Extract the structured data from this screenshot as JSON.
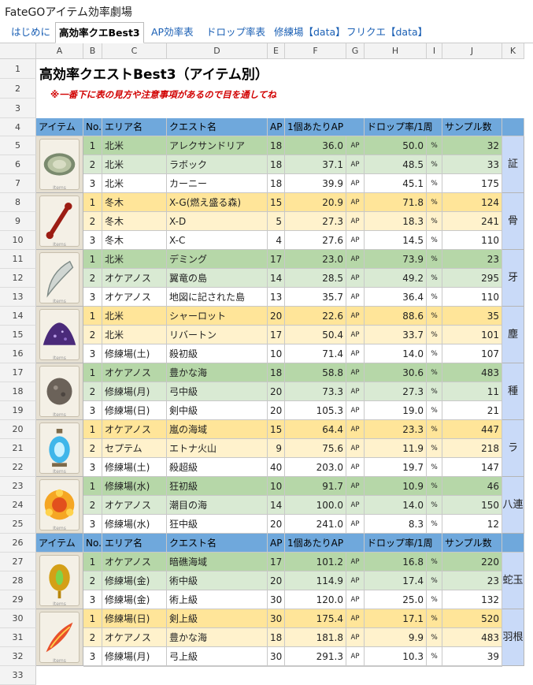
{
  "app": {
    "title": "FateGOアイテム効率劇場"
  },
  "tabs": [
    {
      "label": "はじめに",
      "active": false
    },
    {
      "label": "高効率クエBest3",
      "active": true
    },
    {
      "label": "AP効率表",
      "active": false
    },
    {
      "label": "ドロップ率表",
      "active": false
    },
    {
      "label": "修練場【data】",
      "active": false
    },
    {
      "label": "フリクエ【data】",
      "active": false
    }
  ],
  "columns": [
    "A",
    "B",
    "C",
    "D",
    "E",
    "F",
    "G",
    "H",
    "I",
    "J",
    "K"
  ],
  "sheet": {
    "title": "高効率クエストBest3（アイテム別）",
    "note": "※一番下に表の見方や注意事項があるので目を通してね",
    "header": {
      "item": "アイテム",
      "no": "No.",
      "area": "エリア名",
      "quest": "クエスト名",
      "ap": "AP",
      "ap_per": "1個あたりAP",
      "drop": "ドロップ率/1周",
      "sample": "サンプル数"
    },
    "unit_ap": "AP",
    "unit_pct": "%",
    "item_caption": "Items",
    "groups": [
      {
        "label": "証",
        "theme": "green",
        "icon": "proof-medallion-icon",
        "rows": [
          {
            "no": "1",
            "area": "北米",
            "quest": "アレクサンドリア",
            "ap": "18",
            "ap_per": "36.0",
            "drop": "50.0",
            "sample": "32"
          },
          {
            "no": "2",
            "area": "北米",
            "quest": "ラボック",
            "ap": "18",
            "ap_per": "37.1",
            "drop": "48.5",
            "sample": "33"
          },
          {
            "no": "3",
            "area": "北米",
            "quest": "カーニー",
            "ap": "18",
            "ap_per": "39.9",
            "drop": "45.1",
            "sample": "175"
          }
        ]
      },
      {
        "label": "骨",
        "theme": "yellow",
        "icon": "bone-icon",
        "rows": [
          {
            "no": "1",
            "area": "冬木",
            "quest": "X-G(燃え盛る森)",
            "ap": "15",
            "ap_per": "20.9",
            "drop": "71.8",
            "sample": "124"
          },
          {
            "no": "2",
            "area": "冬木",
            "quest": "X-D",
            "ap": "5",
            "ap_per": "27.3",
            "drop": "18.3",
            "sample": "241"
          },
          {
            "no": "3",
            "area": "冬木",
            "quest": "X-C",
            "ap": "4",
            "ap_per": "27.6",
            "drop": "14.5",
            "sample": "110"
          }
        ]
      },
      {
        "label": "牙",
        "theme": "green",
        "icon": "fang-icon",
        "rows": [
          {
            "no": "1",
            "area": "北米",
            "quest": "デミング",
            "ap": "17",
            "ap_per": "23.0",
            "drop": "73.9",
            "sample": "23"
          },
          {
            "no": "2",
            "area": "オケアノス",
            "quest": "翼竜の島",
            "ap": "14",
            "ap_per": "28.5",
            "drop": "49.2",
            "sample": "295"
          },
          {
            "no": "3",
            "area": "オケアノス",
            "quest": "地図に記された島",
            "ap": "13",
            "ap_per": "35.7",
            "drop": "36.4",
            "sample": "110"
          }
        ]
      },
      {
        "label": "塵",
        "theme": "yellow",
        "icon": "dust-pile-icon",
        "rows": [
          {
            "no": "1",
            "area": "北米",
            "quest": "シャーロット",
            "ap": "20",
            "ap_per": "22.6",
            "drop": "88.6",
            "sample": "35"
          },
          {
            "no": "2",
            "area": "北米",
            "quest": "リバートン",
            "ap": "17",
            "ap_per": "50.4",
            "drop": "33.7",
            "sample": "101"
          },
          {
            "no": "3",
            "area": "修練場(土)",
            "quest": "殺初級",
            "ap": "10",
            "ap_per": "71.4",
            "drop": "14.0",
            "sample": "107"
          }
        ]
      },
      {
        "label": "種",
        "theme": "green",
        "icon": "seed-icon",
        "rows": [
          {
            "no": "1",
            "area": "オケアノス",
            "quest": "豊かな海",
            "ap": "18",
            "ap_per": "58.8",
            "drop": "30.6",
            "sample": "483"
          },
          {
            "no": "2",
            "area": "修練場(月)",
            "quest": "弓中級",
            "ap": "20",
            "ap_per": "73.3",
            "drop": "27.3",
            "sample": "11"
          },
          {
            "no": "3",
            "area": "修練場(日)",
            "quest": "剣中級",
            "ap": "20",
            "ap_per": "105.3",
            "drop": "19.0",
            "sample": "21"
          }
        ]
      },
      {
        "label": "ラ",
        "theme": "yellow",
        "icon": "lantern-icon",
        "rows": [
          {
            "no": "1",
            "area": "オケアノス",
            "quest": "嵐の海域",
            "ap": "15",
            "ap_per": "64.4",
            "drop": "23.3",
            "sample": "447"
          },
          {
            "no": "2",
            "area": "セプテム",
            "quest": "エトナ火山",
            "ap": "9",
            "ap_per": "75.6",
            "drop": "11.9",
            "sample": "218"
          },
          {
            "no": "3",
            "area": "修練場(土)",
            "quest": "殺超級",
            "ap": "40",
            "ap_per": "203.0",
            "drop": "19.7",
            "sample": "147"
          }
        ]
      },
      {
        "label": "八連",
        "theme": "green",
        "icon": "octuplet-crystal-icon",
        "rows": [
          {
            "no": "1",
            "area": "修練場(水)",
            "quest": "狂初級",
            "ap": "10",
            "ap_per": "91.7",
            "drop": "10.9",
            "sample": "46"
          },
          {
            "no": "2",
            "area": "オケアノス",
            "quest": "潮目の海",
            "ap": "14",
            "ap_per": "100.0",
            "drop": "14.0",
            "sample": "150"
          },
          {
            "no": "3",
            "area": "修練場(水)",
            "quest": "狂中級",
            "ap": "20",
            "ap_per": "241.0",
            "drop": "8.3",
            "sample": "12"
          }
        ]
      },
      {
        "label": "蛇玉",
        "theme": "green",
        "icon": "serpent-jewel-icon",
        "rows": [
          {
            "no": "1",
            "area": "オケアノス",
            "quest": "暗礁海域",
            "ap": "17",
            "ap_per": "101.2",
            "drop": "16.8",
            "sample": "220"
          },
          {
            "no": "2",
            "area": "修練場(金)",
            "quest": "術中級",
            "ap": "20",
            "ap_per": "114.9",
            "drop": "17.4",
            "sample": "23"
          },
          {
            "no": "3",
            "area": "修練場(金)",
            "quest": "術上級",
            "ap": "30",
            "ap_per": "120.0",
            "drop": "25.0",
            "sample": "132"
          }
        ]
      },
      {
        "label": "羽根",
        "theme": "yellow",
        "icon": "phoenix-feather-icon",
        "rows": [
          {
            "no": "1",
            "area": "修練場(日)",
            "quest": "剣上級",
            "ap": "30",
            "ap_per": "175.4",
            "drop": "17.1",
            "sample": "520"
          },
          {
            "no": "2",
            "area": "オケアノス",
            "quest": "豊かな海",
            "ap": "18",
            "ap_per": "181.8",
            "drop": "9.9",
            "sample": "483"
          },
          {
            "no": "3",
            "area": "修練場(月)",
            "quest": "弓上級",
            "ap": "30",
            "ap_per": "291.3",
            "drop": "10.3",
            "sample": "39"
          }
        ]
      }
    ],
    "row_numbers": [
      "1",
      "2",
      "3",
      "4",
      "5",
      "6",
      "7",
      "8",
      "9",
      "10",
      "11",
      "12",
      "13",
      "14",
      "15",
      "16",
      "17",
      "18",
      "19",
      "20",
      "21",
      "22",
      "23",
      "24",
      "25",
      "26",
      "27",
      "28",
      "29",
      "30",
      "31",
      "32",
      "33"
    ]
  }
}
